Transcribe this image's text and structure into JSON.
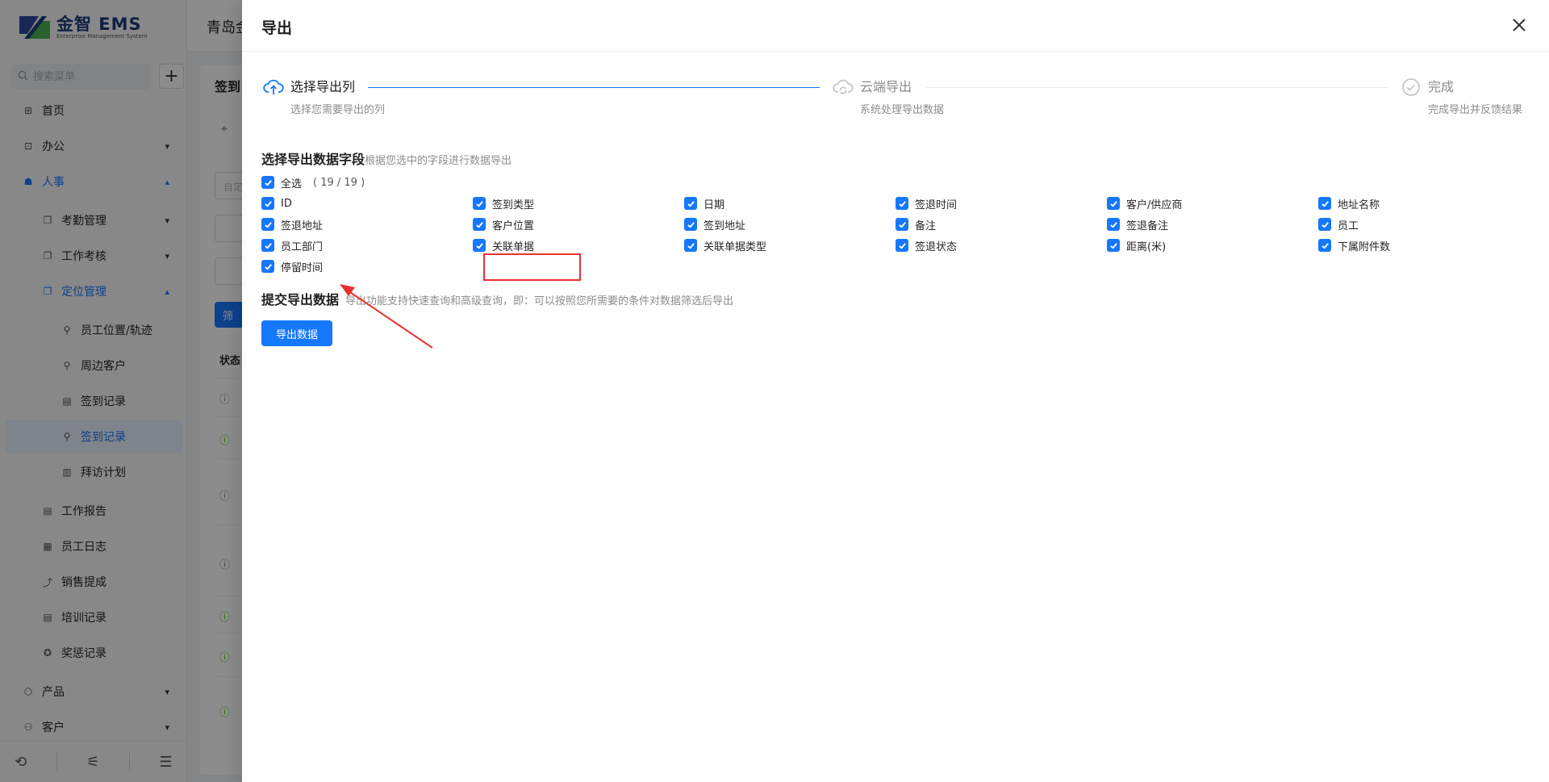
{
  "app": {
    "logo_main": "金智 EMS",
    "logo_sub": "Enterprise Management System",
    "company": "青岛金",
    "search_placeholder": "搜索菜单"
  },
  "sidebar": {
    "items": [
      {
        "label": "首页",
        "icon": "home-icon"
      },
      {
        "label": "办公",
        "icon": "office-icon"
      },
      {
        "label": "人事",
        "icon": "user-icon"
      },
      {
        "label": "考勤管理",
        "icon": "copy-icon"
      },
      {
        "label": "工作考核",
        "icon": "copy-icon"
      },
      {
        "label": "定位管理",
        "icon": "copy-icon"
      },
      {
        "label": "员工位置/轨迹",
        "icon": "person-location-icon"
      },
      {
        "label": "周边客户",
        "icon": "person-location-icon"
      },
      {
        "label": "签到记录",
        "icon": "form-icon"
      },
      {
        "label": "签到记录",
        "icon": "person-location-icon"
      },
      {
        "label": "拜访计划",
        "icon": "file-icon"
      },
      {
        "label": "工作报告",
        "icon": "form-icon"
      },
      {
        "label": "员工日志",
        "icon": "calendar-icon"
      },
      {
        "label": "销售提成",
        "icon": "chart-icon"
      },
      {
        "label": "培训记录",
        "icon": "form-icon"
      },
      {
        "label": "奖惩记录",
        "icon": "award-icon"
      },
      {
        "label": "产品",
        "icon": "box-icon"
      },
      {
        "label": "客户",
        "icon": "customer-icon"
      }
    ]
  },
  "background": {
    "page_title": "签到",
    "field_placeholder": "自定",
    "filter_button": "筛",
    "table_header": "状态"
  },
  "drawer": {
    "title": "导出",
    "steps": [
      {
        "title": "选择导出列",
        "desc": "选择您需要导出的列",
        "state": "active"
      },
      {
        "title": "云端导出",
        "desc": "系统处理导出数据",
        "state": "wait"
      },
      {
        "title": "完成",
        "desc": "完成导出并反馈结果",
        "state": "wait"
      }
    ],
    "fields_section": {
      "title": "选择导出数据字段",
      "desc": "根据您选中的字段进行数据导出",
      "select_all": "全选",
      "count": "( 19 / 19 )",
      "fields": [
        "ID",
        "签到类型",
        "日期",
        "签退时间",
        "客户/供应商",
        "地址名称",
        "签退地址",
        "客户位置",
        "签到地址",
        "备注",
        "签退备注",
        "员工",
        "员工部门",
        "关联单据",
        "关联单据类型",
        "签退状态",
        "距离(米)",
        "下属附件数",
        "停留时间"
      ]
    },
    "submit_section": {
      "title": "提交导出数据",
      "desc": "导出功能支持快速查询和高级查询，即：可以按照您所需要的条件对数据筛选后导出"
    },
    "export_button": "导出数据"
  },
  "colors": {
    "primary": "#1677ff",
    "highlight": "#e8302f",
    "mask": "rgba(0,0,0,0.45)"
  }
}
